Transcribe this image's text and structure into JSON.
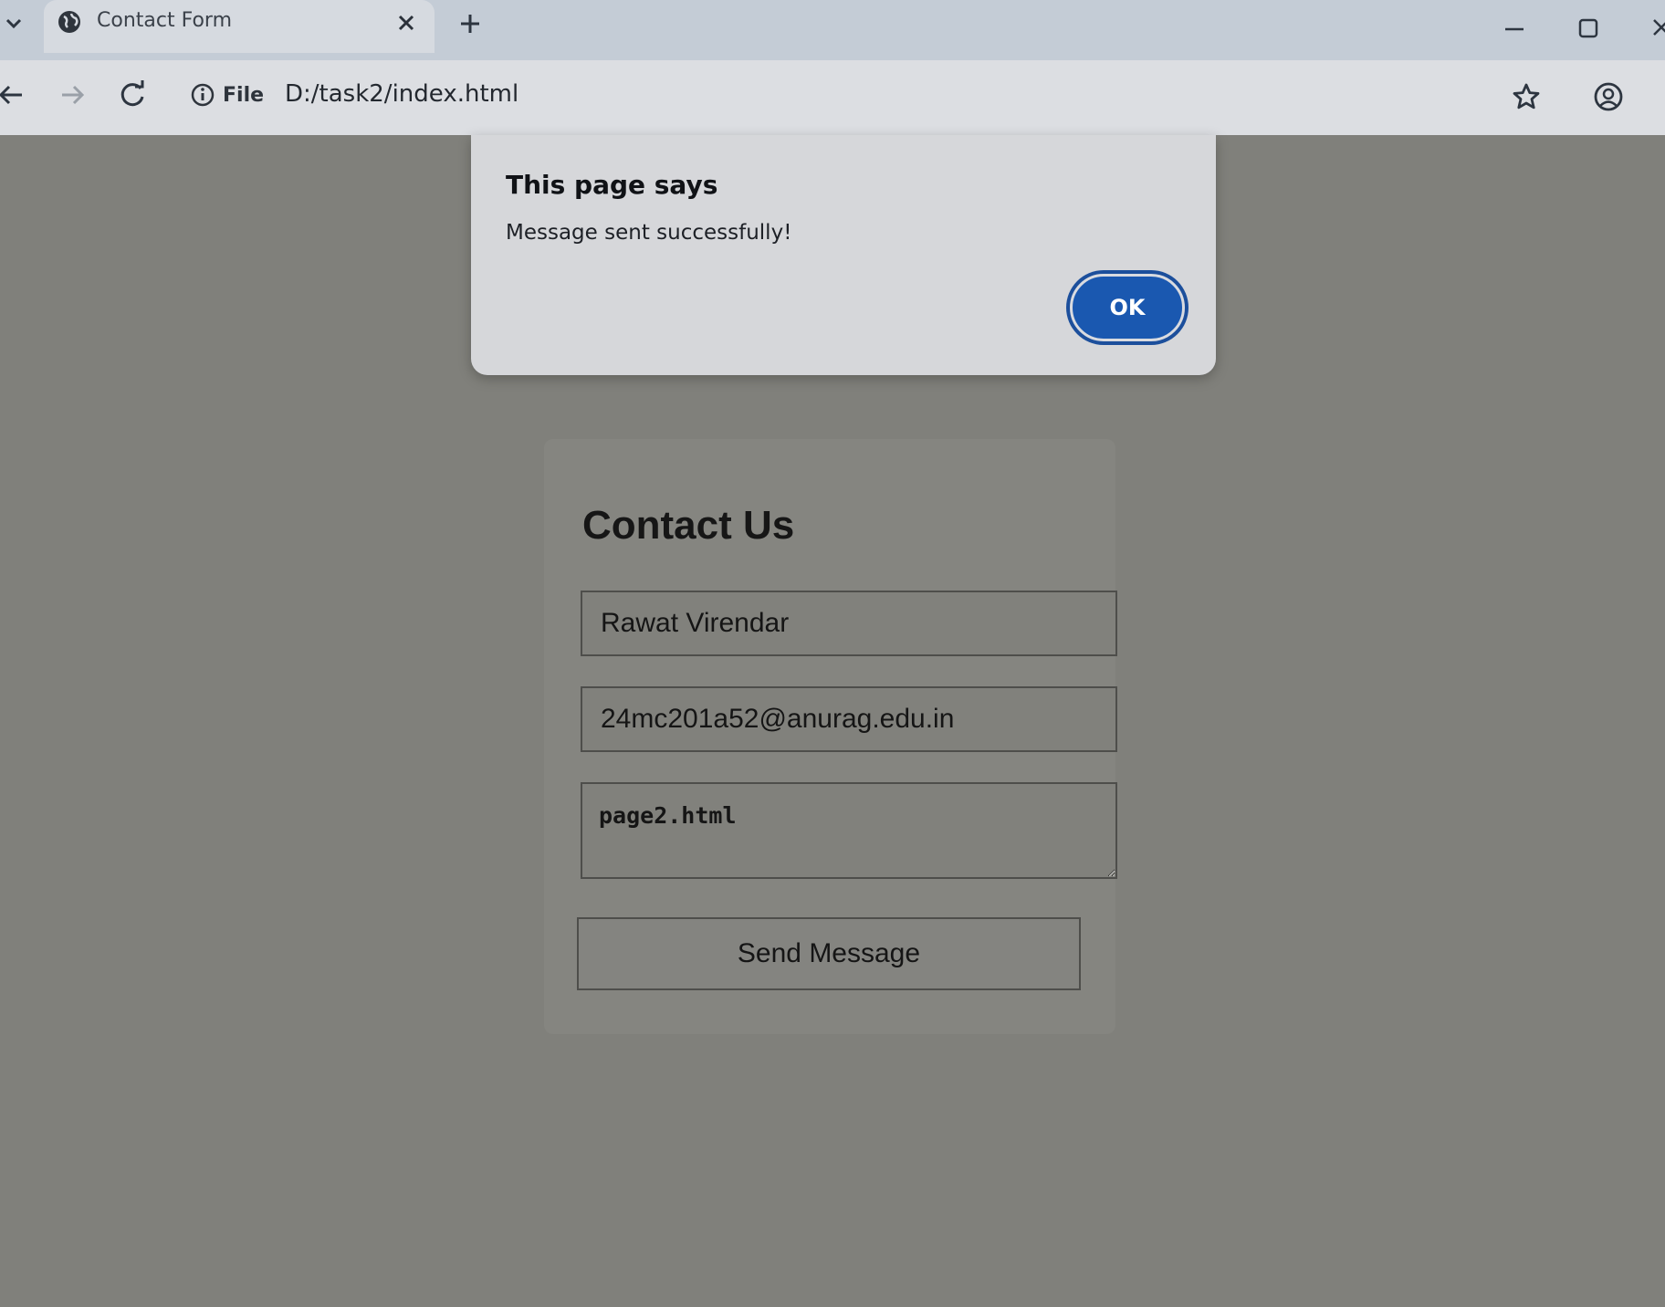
{
  "browser": {
    "tab": {
      "title": "Contact Form",
      "icon": "globe-icon"
    },
    "new_tab_icon": "plus-icon",
    "toolbar": {
      "site_info_label": "File",
      "address": "D:/task2/index.html"
    },
    "icons": [
      "chevron-down-icon",
      "back-arrow-icon",
      "forward-arrow-icon",
      "reload-icon",
      "info-icon",
      "star-icon",
      "profile-icon",
      "minimize-icon",
      "maximize-icon",
      "close-icon"
    ]
  },
  "page": {
    "form": {
      "title": "Contact Us",
      "name_value": "Rawat Virendar",
      "email_value": "24mc201a52@anurag.edu.in",
      "message_value": "page2.html",
      "submit_label": "Send Message"
    }
  },
  "dialog": {
    "title": "This page says",
    "message": "Message sent successfully!",
    "ok_label": "OK",
    "ok_color": "#1a58b0"
  }
}
